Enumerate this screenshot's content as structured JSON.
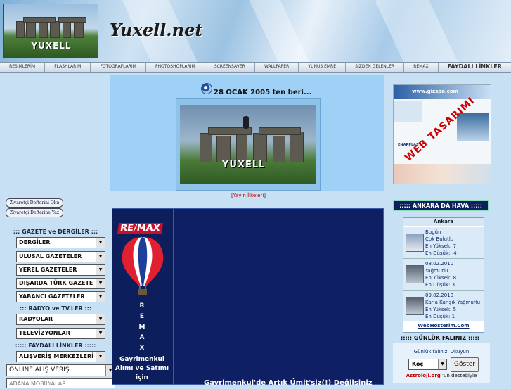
{
  "site": {
    "title": "Yuxell.net",
    "logo_text": "YUXELL"
  },
  "nav": {
    "items": [
      "RESİMLERİM",
      "FLASHLARIM",
      "FOTOGRAFLARIM",
      "PHOTOSHOPLARIM",
      "SCREENSAVER",
      "WALLPAPER",
      "YUNUS EMRE",
      "SİZDEN GELENLER",
      "REMAX",
      "FAYDALI LİNKLER"
    ]
  },
  "counter": {
    "text": "28 OCAK 2005 ten beri..."
  },
  "photo": {
    "text": "YUXELL"
  },
  "policy": {
    "text": "Yayın İlkeleri"
  },
  "ad": {
    "stamp": "WEB TASARIMI",
    "site": "www.gizspa.com",
    "brand": "ENARPLAST"
  },
  "guestbook": {
    "read": "Ziyaretçi Defterini Oku",
    "write": "Ziyaretçi Defterine Yaz"
  },
  "sections": {
    "gazete": {
      "title": "::: GAZETE ve DERGİLER :::",
      "items": [
        "DERGİLER",
        "ULUSAL GAZETELER",
        "YEREL GAZETELER",
        "DIŞARDA TÜRK GAZETE",
        "YABANCI GAZETELER"
      ]
    },
    "radyo": {
      "title": "::: RADYO ve TV.LER :::",
      "items": [
        "RADYOLAR",
        "TELEVİZYONLAR"
      ]
    },
    "linkler": {
      "title": "::::: FAYDALI LİNKLER :::::",
      "items": [
        "ALIŞVERİŞ MERKEZLERİ"
      ]
    },
    "online": "ONLİNE ALIŞ VERİŞ",
    "partial": "ADANA MOBİLYALAR"
  },
  "remax": {
    "logo": "RE/MAX",
    "letters": [
      "R",
      "E",
      "M",
      "A",
      "X"
    ],
    "tagline": "Gayrimenkul Alımı ve Satımı için",
    "ticker": "Gayrimenkul'de Artık Ümit'siz(!) Değilsiniz"
  },
  "weather": {
    "header": "::::: ANKARA DA HAVA :::::",
    "city": "Ankara",
    "days": [
      {
        "day": "Bugün",
        "cond": "Çok Bulutlu",
        "high": "En Yüksek: 7",
        "low": "En Düşük: -4"
      },
      {
        "day": "08.02.2010",
        "cond": "Yağmurlu",
        "high": "En Yüksek: 8",
        "low": "En Düşük: 3"
      },
      {
        "day": "09.02.2010",
        "cond": "Karla Karışık Yağmurlu",
        "high": "En Yüksek: 5",
        "low": "En Düşük: 1"
      }
    ],
    "footer": "WebHosterim.Com"
  },
  "fal": {
    "header": "::::: GÜNLÜK FALINIZ :::::",
    "sub": "Günlük falınızı Okuyun",
    "select": "Koç",
    "button": "Göster",
    "credit_link": "Astroloji.org",
    "credit_rest": " 'un desteğiyle"
  }
}
